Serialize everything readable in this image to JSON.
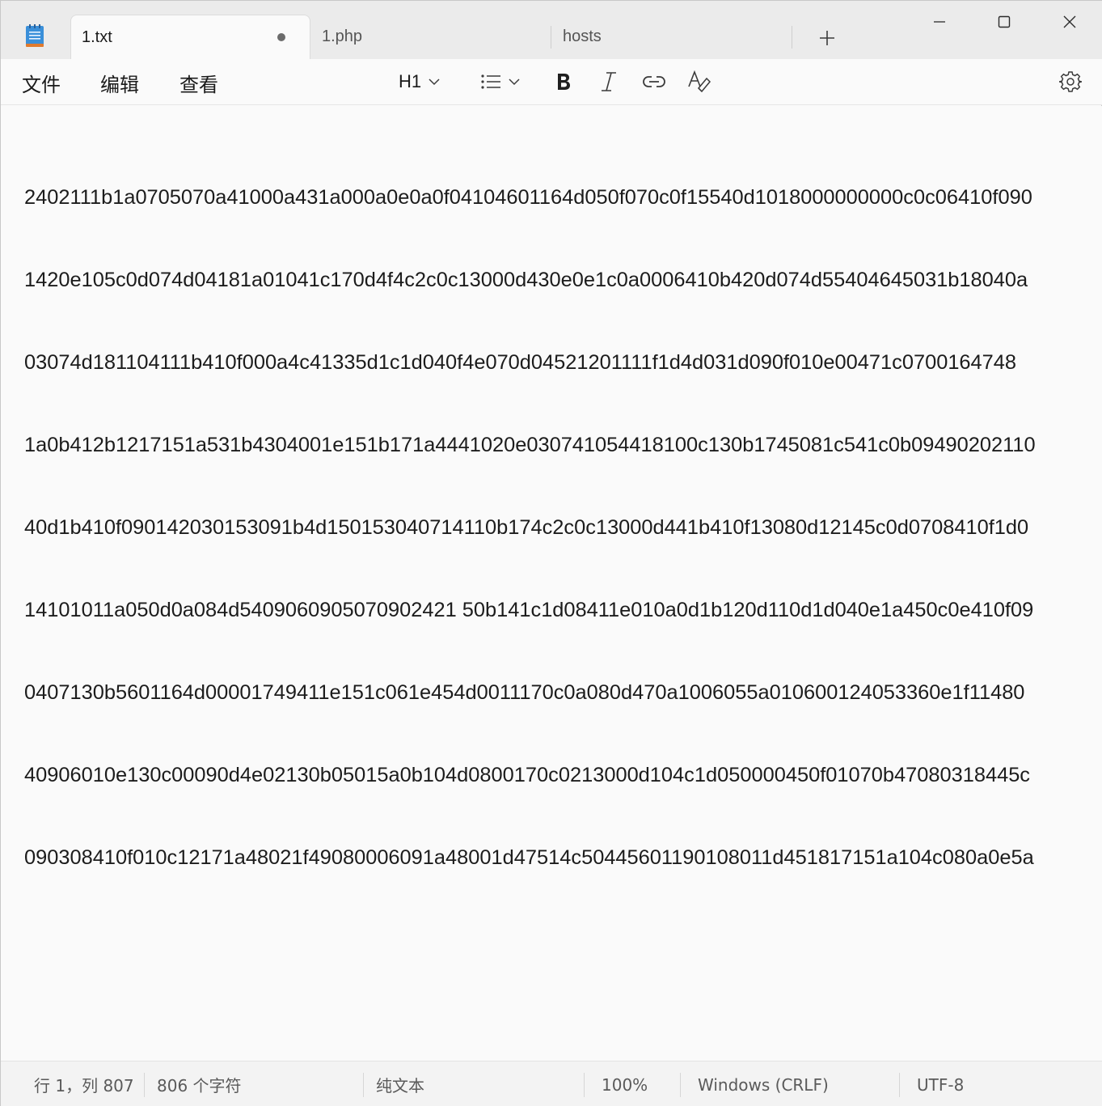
{
  "tabs": [
    {
      "label": "1.txt",
      "active": true,
      "unsaved": true
    },
    {
      "label": "1.php",
      "active": false
    },
    {
      "label": "hosts",
      "active": false
    }
  ],
  "menu": {
    "file": "文件",
    "edit": "编辑",
    "view": "查看"
  },
  "toolbar": {
    "heading": "H1",
    "icons": [
      "list-icon",
      "bold-icon",
      "italic-icon",
      "link-icon",
      "spellcheck-icon",
      "gear-icon"
    ]
  },
  "editor": {
    "lines": [
      "2402111b1a0705070a41000a431a000a0e0a0f04104601164d050f070c0f15540d1018000000000c0c06410f090",
      "1420e105c0d074d04181a01041c170d4f4c2c0c13000d430e0e1c0a0006410b420d074d55404645031b18040a",
      "03074d181104111b410f000a4c41335d1c1d040f4e070d04521201111f1d4d031d090f010e00471c0700164748",
      "1a0b412b1217151a531b4304001e151b171a4441020e030741054418100c130b1745081c541c0b09490202110",
      "40d1b410f090142030153091b4d150153040714110b174c2c0c13000d441b410f13080d12145c0d0708410f1d0",
      "14101011a050d0a084d5409060905070902421 50b141c1d08411e010a0d1b120d110d1d040e1a450c0e410f09",
      "0407130b5601164d00001749411e151c061e454d0011170c0a080d470a1006055a010600124053360e1f11480",
      "40906010e130c00090d4e02130b05015a0b104d0800170c0213000d104c1d050000450f01070b47080318445c",
      "090308410f010c12171a48021f49080006091a48001d47514c50445601190108011d451817151a104c080a0e5a"
    ]
  },
  "status": {
    "position": "行 1，列 807",
    "chars": "806 个字符",
    "type": "纯文本",
    "zoom": "100%",
    "eol": "Windows (CRLF)",
    "encoding": "UTF-8"
  }
}
